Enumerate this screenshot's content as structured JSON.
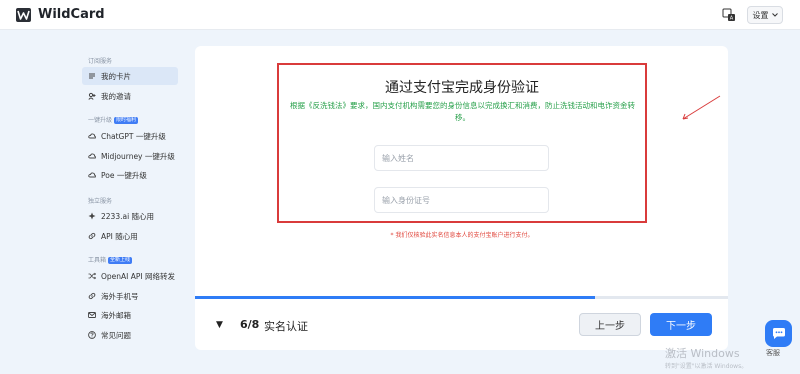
{
  "app": {
    "brand": "WildCard"
  },
  "header": {
    "settings_label": "设置"
  },
  "sidebar": {
    "sections": [
      {
        "title": "订阅服务",
        "badge": ""
      },
      {
        "title": "一键升级",
        "badge": "限时福利"
      },
      {
        "title": "独立服务",
        "badge": ""
      },
      {
        "title": "工具箱",
        "badge": "全新上线"
      }
    ],
    "items": [
      {
        "label": "我的卡片",
        "icon": "card-icon",
        "active": true
      },
      {
        "label": "我的邀请",
        "icon": "invite-icon"
      },
      {
        "label": "ChatGPT 一键升级",
        "icon": "cloud-icon"
      },
      {
        "label": "Midjourney 一键升级",
        "icon": "cloud-icon"
      },
      {
        "label": "Poe 一键升级",
        "icon": "cloud-icon"
      },
      {
        "label": "2233.ai 随心用",
        "icon": "sparkle-icon"
      },
      {
        "label": "API 随心用",
        "icon": "link-icon"
      },
      {
        "label": "OpenAI API 网络转发",
        "icon": "shuffle-icon"
      },
      {
        "label": "海外手机号",
        "icon": "link-icon"
      },
      {
        "label": "海外邮箱",
        "icon": "mail-icon"
      },
      {
        "label": "常见问题",
        "icon": "help-icon"
      }
    ]
  },
  "verify": {
    "title": "通过支付宝完成身份验证",
    "description": "根据《反洗钱法》要求，国内支付机构需要您的身份信息以完成换汇和消费，防止洗钱活动和电诈资金转移。",
    "name_placeholder": "输入姓名",
    "id_placeholder": "输入身份证号",
    "notice": "* 我们仅核验此实名信息本人的支付宝账户进行支付。"
  },
  "progress": {
    "fraction": 0.75
  },
  "step": {
    "toggle_glyph": "▼",
    "count": "6/8",
    "name": "实名认证",
    "prev_label": "上一步",
    "next_label": "下一步"
  },
  "support": {
    "label": "客服"
  },
  "watermark": {
    "title": "激活 Windows",
    "subtitle": "转到\"设置\"以激活 Windows。"
  },
  "colors": {
    "accent": "#2f7cf6",
    "alert_border": "#d93b3b",
    "legal_text": "#27a04a",
    "notice_text": "#e0443a"
  }
}
